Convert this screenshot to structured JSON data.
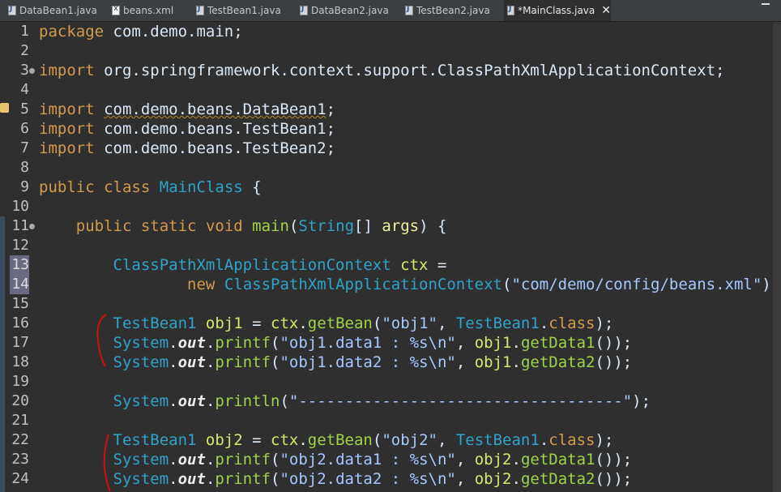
{
  "tabs": [
    {
      "label": "DataBean1.java",
      "icon": "java-file-icon",
      "active": false
    },
    {
      "label": "beans.xml",
      "icon": "xml-file-icon",
      "active": false
    },
    {
      "label": "TestBean1.java",
      "icon": "java-file-icon",
      "active": false
    },
    {
      "label": "DataBean2.java",
      "icon": "java-file-icon",
      "active": false
    },
    {
      "label": "TestBean2.java",
      "icon": "java-file-icon",
      "active": false
    },
    {
      "label": "*MainClass.java",
      "icon": "java-file-icon",
      "active": true
    }
  ],
  "editor": {
    "lines": [
      {
        "n": "1",
        "html": "<span class='k'>package</span> com.demo.main;"
      },
      {
        "n": "2",
        "html": ""
      },
      {
        "n": "3",
        "fold": true,
        "html": "<span class='k'>import</span> org.springframework.context.support.ClassPathXmlApplicationContext;"
      },
      {
        "n": "4",
        "html": ""
      },
      {
        "n": "5",
        "html": "<span class='k'>import</span> <span class='u'>com.demo.beans.DataBean1</span>;"
      },
      {
        "n": "6",
        "html": "<span class='k'>import</span> com.demo.beans.TestBean1;"
      },
      {
        "n": "7",
        "html": "<span class='k'>import</span> com.demo.beans.TestBean2;"
      },
      {
        "n": "8",
        "html": ""
      },
      {
        "n": "9",
        "html": "<span class='k'>public</span> <span class='k'>class</span> <span class='cls'>MainClass</span> {"
      },
      {
        "n": "10",
        "html": ""
      },
      {
        "n": "11",
        "fold": true,
        "html": "    <span class='k'>public</span> <span class='k'>static</span> <span class='k'>void</span> <span class='m'>main</span>(<span class='t'>String</span>[] <span class='p'>args</span>) {"
      },
      {
        "n": "12",
        "html": ""
      },
      {
        "n": "13",
        "hl": true,
        "html": "        <span class='t'>ClassPathXmlApplicationContext</span> <span class='v'>ctx</span> ="
      },
      {
        "n": "14",
        "hl": true,
        "html": "                <span class='k'>new</span> <span class='t'>ClassPathXmlApplicationContext</span>(<span class='s'>\"com/demo/config/beans.xml\"</span>);"
      },
      {
        "n": "15",
        "html": ""
      },
      {
        "n": "16",
        "html": "        <span class='t'>TestBean1</span> <span class='v'>obj1</span> = <span class='v'>ctx</span>.<span class='m'>getBean</span>(<span class='s'>\"obj1\"</span>, <span class='t'>TestBean1</span>.<span class='k'>class</span>);"
      },
      {
        "n": "17",
        "html": "        <span class='t'>System</span>.<span class='f'>out</span>.<span class='m'>printf</span>(<span class='s'>\"obj1.data1 : %s\\n\"</span>, <span class='v'>obj1</span>.<span class='m'>getData1</span>());"
      },
      {
        "n": "18",
        "html": "        <span class='t'>System</span>.<span class='f'>out</span>.<span class='m'>printf</span>(<span class='s'>\"obj1.data2 : %s\\n\"</span>, <span class='v'>obj1</span>.<span class='m'>getData2</span>());"
      },
      {
        "n": "19",
        "html": ""
      },
      {
        "n": "20",
        "html": "        <span class='t'>System</span>.<span class='f'>out</span>.<span class='m'>println</span>(<span class='s'>\"-----------------------------------\"</span>);"
      },
      {
        "n": "21",
        "html": ""
      },
      {
        "n": "22",
        "html": "        <span class='t'>TestBean1</span> <span class='v'>obj2</span> = <span class='v'>ctx</span>.<span class='m'>getBean</span>(<span class='s'>\"obj2\"</span>, <span class='t'>TestBean1</span>.<span class='k'>class</span>);"
      },
      {
        "n": "23",
        "html": "        <span class='t'>System</span>.<span class='f'>out</span>.<span class='m'>printf</span>(<span class='s'>\"obj2.data1 : %s\\n\"</span>, <span class='v'>obj2</span>.<span class='m'>getData1</span>());"
      },
      {
        "n": "24",
        "html": "        <span class='t'>System</span>.<span class='f'>out</span>.<span class='m'>printf</span>(<span class='s'>\"obj2.data2 : %s\\n\"</span>, <span class='v'>obj2</span>.<span class='m'>getData2</span>());"
      }
    ]
  },
  "colors": {
    "background": "#2f2f2f",
    "keyword": "#d39a4a",
    "type": "#2fa3c9",
    "method": "#9fd34a",
    "string": "#a6c8ff",
    "variable": "#d8e86a",
    "annotation_mark": "#cc1111"
  }
}
